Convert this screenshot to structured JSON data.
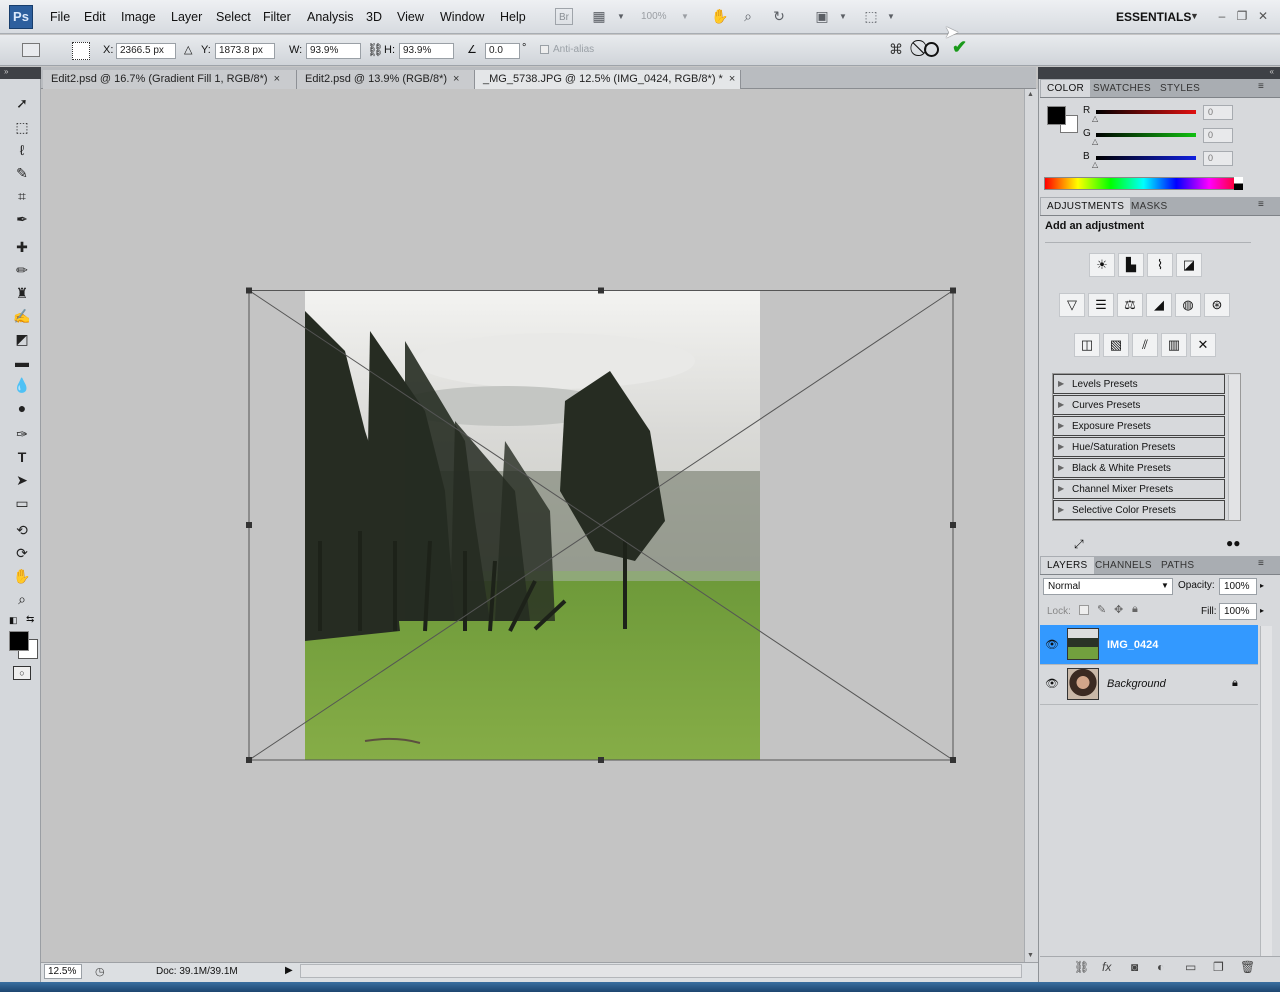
{
  "app": {
    "logo": "Ps"
  },
  "menu": [
    "File",
    "Edit",
    "Image",
    "Layer",
    "Select",
    "Filter",
    "Analysis",
    "3D",
    "View",
    "Window",
    "Help"
  ],
  "app_bar": {
    "bridge": "Br",
    "zoom_value": "100%",
    "workspace": "ESSENTIALS"
  },
  "options": {
    "x_label": "X:",
    "x_value": "2366.5 px",
    "y_label": "Y:",
    "y_value": "1873.8 px",
    "w_label": "W:",
    "w_value": "93.9%",
    "h_label": "H:",
    "h_value": "93.9%",
    "angle_value": "0.0",
    "angle_unit": "°",
    "anti_alias_label": "Anti-alias"
  },
  "tabs": [
    {
      "label": "Edit2.psd @ 16.7% (Gradient Fill 1, RGB/8*)",
      "active": false
    },
    {
      "label": "Edit2.psd @ 13.9% (RGB/8*)",
      "active": false
    },
    {
      "label": "_MG_5738.JPG @ 12.5% (IMG_0424, RGB/8*) *",
      "active": true
    }
  ],
  "tab_close": "×",
  "status": {
    "zoom": "12.5%",
    "doc": "Doc: 39.1M/39.1M"
  },
  "color_panel": {
    "tabs": [
      "COLOR",
      "SWATCHES",
      "STYLES"
    ],
    "channels": [
      {
        "label": "R",
        "value": "0",
        "color": "#e01010"
      },
      {
        "label": "G",
        "value": "0",
        "color": "#10c010"
      },
      {
        "label": "B",
        "value": "0",
        "color": "#1020e0"
      }
    ]
  },
  "adjustments_panel": {
    "tabs": [
      "ADJUSTMENTS",
      "MASKS"
    ],
    "title": "Add an adjustment",
    "presets": [
      "Levels Presets",
      "Curves Presets",
      "Exposure Presets",
      "Hue/Saturation Presets",
      "Black & White Presets",
      "Channel Mixer Presets",
      "Selective Color Presets"
    ]
  },
  "layers_panel": {
    "tabs": [
      "LAYERS",
      "CHANNELS",
      "PATHS"
    ],
    "blend_mode": "Normal",
    "opacity_label": "Opacity:",
    "opacity_value": "100%",
    "lock_label": "Lock:",
    "fill_label": "Fill:",
    "fill_value": "100%",
    "layers": [
      {
        "name": "IMG_0424",
        "selected": true
      },
      {
        "name": "Background",
        "selected": false
      }
    ]
  },
  "colors": {
    "accent": "#3399ff",
    "panel": "#d7d9dc",
    "canvas": "#c4c4c4"
  }
}
